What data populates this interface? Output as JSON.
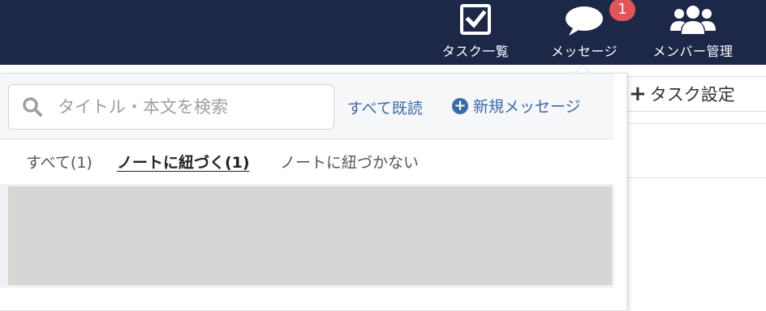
{
  "nav": {
    "tasks_label": "タスク一覧",
    "messages_label": "メッセージ",
    "members_label": "メンバー管理",
    "message_badge": "1",
    "icons": [
      "checkbox-icon",
      "speech-bubble-icon",
      "users-icon"
    ]
  },
  "background": {
    "task_settings_label": "タスク設定"
  },
  "panel": {
    "search_placeholder": "タイトル・本文を検索",
    "mark_all_read": "すべて既読",
    "new_message": "新規メッセージ",
    "tabs": [
      {
        "label": "すべて(1)",
        "active": false
      },
      {
        "label": "ノートに紐づく(1)",
        "active": true
      },
      {
        "label": "ノートに紐づかない",
        "active": false
      }
    ]
  },
  "colors": {
    "nav_bg": "#1d2747",
    "accent": "#3b6aa8",
    "badge": "#e25457"
  }
}
